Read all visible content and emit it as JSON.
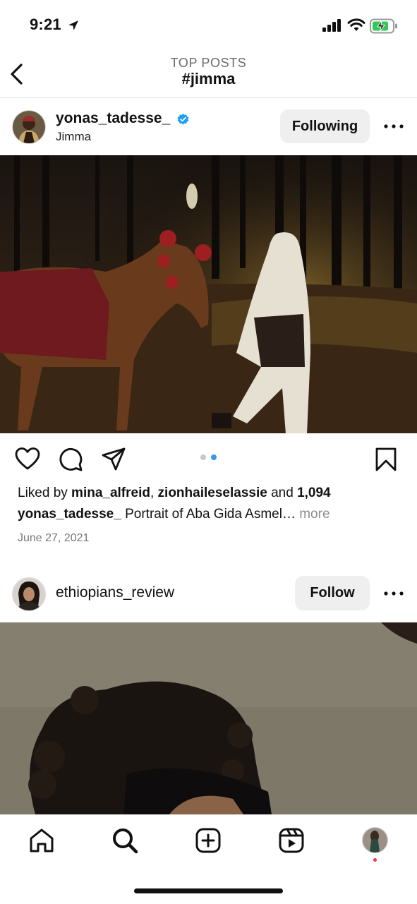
{
  "status_bar": {
    "time": "9:21"
  },
  "header": {
    "subtitle": "TOP POSTS",
    "title": "#jimma"
  },
  "post1": {
    "username": "yonas_tadesse_",
    "location": "Jimma",
    "follow_label": "Following",
    "carousel": {
      "count": 2,
      "active": 2
    },
    "likes": {
      "prefix": "Liked by ",
      "user1": "mina_alfreid",
      "sep": ", ",
      "user2": "zionhaileselassie",
      "mid": " and ",
      "count": "1,094"
    },
    "caption": {
      "user": "yonas_tadesse_",
      "text": " Portrait of Aba Gida Asmel…",
      "more": " more"
    },
    "date": "June 27, 2021"
  },
  "post2": {
    "username": "ethiopians_review",
    "follow_label": "Follow"
  },
  "colors": {
    "accent": "#3897f0",
    "notification": "#ff3040",
    "verified": "#1da1f2"
  },
  "icons": [
    "back-chevron-icon",
    "verified-icon",
    "more-icon",
    "heart-icon",
    "comment-icon",
    "share-icon",
    "bookmark-icon",
    "home-icon",
    "search-icon",
    "create-icon",
    "reels-icon",
    "profile-avatar"
  ]
}
